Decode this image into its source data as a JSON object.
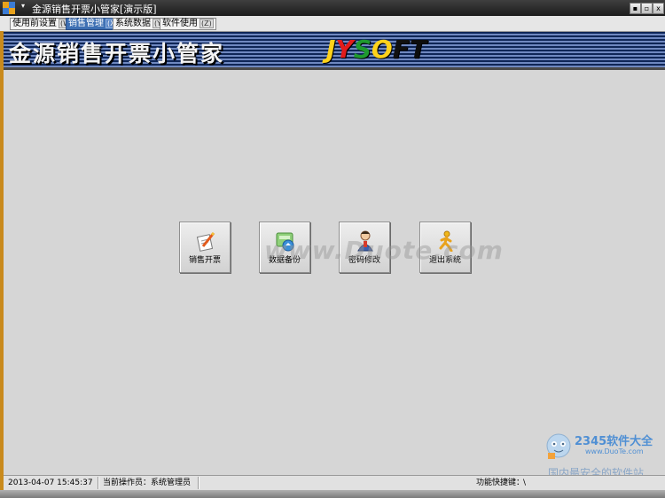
{
  "window": {
    "title": "金源销售开票小管家[演示版]",
    "sysmenu_glyph": "▾",
    "buttons": {
      "minimize": "▪",
      "restore": "▫",
      "close": "x"
    }
  },
  "menu": [
    {
      "label": "使用前设置",
      "key": "(W)",
      "active": false
    },
    {
      "label": "销售管理",
      "key": "(X)",
      "active": true
    },
    {
      "label": "系统数据",
      "key": "(Y)",
      "active": false
    },
    {
      "label": "软件使用",
      "key": "(Z)",
      "active": false
    }
  ],
  "banner": {
    "title": "金源销售开票小管家",
    "logo": [
      "J",
      "Y",
      "S",
      "O",
      "F",
      "T"
    ],
    "logo_colors": [
      "#ffd21a",
      "#e21b1b",
      "#1f9a2f",
      "#ffd21a",
      "#111111",
      "#0d0d0d"
    ]
  },
  "actions": [
    {
      "label": "销售开票",
      "icon": "invoice-pen-icon"
    },
    {
      "label": "数据备份",
      "icon": "data-backup-icon"
    },
    {
      "label": "密码修改",
      "icon": "user-password-icon"
    },
    {
      "label": "退出系统",
      "icon": "exit-runner-icon"
    }
  ],
  "watermark": {
    "center": "www.Duote.com",
    "brand": "2345软件大全",
    "url": "www.DuoTe.com",
    "slogan": "国内最安全的软件站"
  },
  "status": {
    "datetime": "2013-04-07 15:45:37",
    "operator_label": "当前操作员：系统管理员",
    "shortcut_label": "功能快捷键：",
    "shortcut_value": "\\"
  }
}
